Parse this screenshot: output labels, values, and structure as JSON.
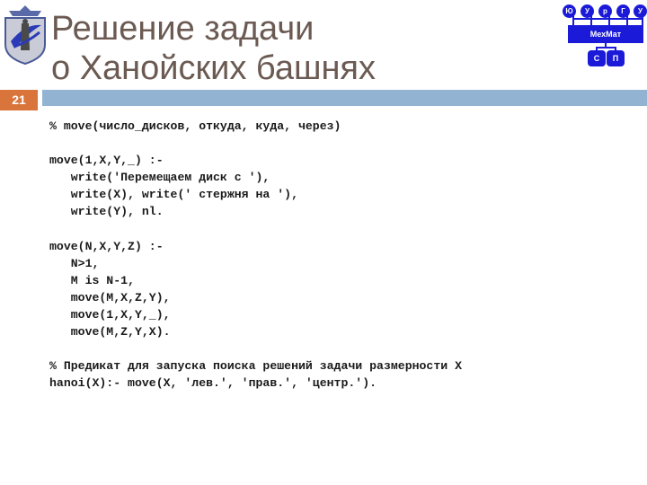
{
  "header": {
    "title_lines": [
      "Решение задачи",
      "о Ханойских башнях"
    ],
    "slide_number": "21"
  },
  "logo": {
    "icon": "university-crest-icon"
  },
  "mexmat_diagram": {
    "top_nodes": [
      "Ю",
      "У",
      "р",
      "Г",
      "У"
    ],
    "center_label": "МехМат",
    "bottom_nodes": [
      "С",
      "П"
    ],
    "color": "#1a1ad8"
  },
  "colors": {
    "slide_number_bg": "#d9743a",
    "header_bar": "#93b3d3",
    "title_text": "#6b5a52"
  },
  "code": {
    "lines": [
      "% move(число_дисков, откуда, куда, через)",
      "",
      "move(1,X,Y,_) :-",
      "   write('Перемещаем диск с '),",
      "   write(X), write(' стержня на '),",
      "   write(Y), nl.",
      "",
      "move(N,X,Y,Z) :-",
      "   N>1,",
      "   M is N-1,",
      "   move(M,X,Z,Y),",
      "   move(1,X,Y,_),",
      "   move(M,Z,Y,X).",
      "",
      "% Предикат для запуска поиска решений задачи размерности X",
      "hanoi(X):- move(X, 'лев.', 'прав.', 'центр.')."
    ]
  }
}
